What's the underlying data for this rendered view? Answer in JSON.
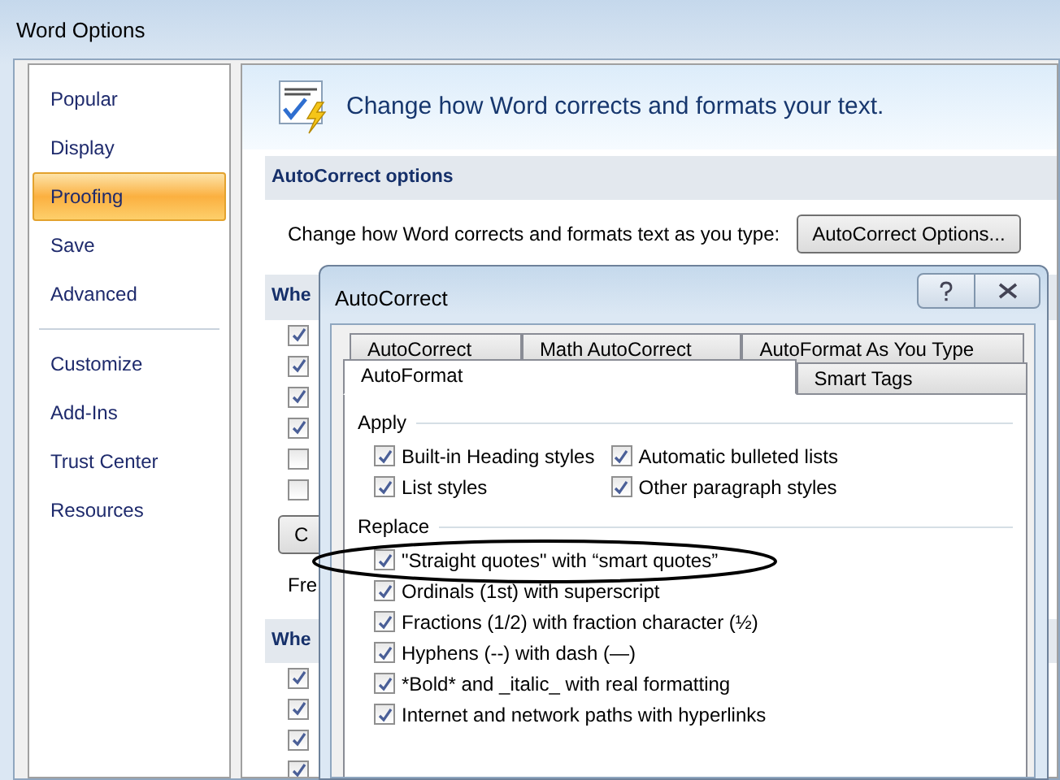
{
  "window": {
    "title": "Word Options"
  },
  "sidebar": {
    "groups": [
      {
        "items": [
          {
            "label": "Popular",
            "selected": false
          },
          {
            "label": "Display",
            "selected": false
          },
          {
            "label": "Proofing",
            "selected": true
          },
          {
            "label": "Save",
            "selected": false
          },
          {
            "label": "Advanced",
            "selected": false
          }
        ]
      },
      {
        "items": [
          {
            "label": "Customize",
            "selected": false
          },
          {
            "label": "Add-Ins",
            "selected": false
          },
          {
            "label": "Trust Center",
            "selected": false
          },
          {
            "label": "Resources",
            "selected": false
          }
        ]
      }
    ]
  },
  "header": {
    "title": "Change how Word corrects and formats your text."
  },
  "sections": [
    {
      "title": "AutoCorrect options",
      "rows": [
        {
          "kind": "action",
          "text": "Change how Word corrects and formats text as you type:",
          "button": "AutoCorrect Options..."
        }
      ]
    },
    {
      "title": "Whe",
      "rows": [
        {
          "kind": "checkbox",
          "checked": true
        },
        {
          "kind": "checkbox",
          "checked": true
        },
        {
          "kind": "checkbox",
          "checked": true
        },
        {
          "kind": "checkbox",
          "checked": true
        },
        {
          "kind": "checkbox",
          "checked": false
        },
        {
          "kind": "checkbox",
          "checked": false
        },
        {
          "kind": "button",
          "label": "C"
        },
        {
          "kind": "text",
          "text": "Fre"
        }
      ]
    },
    {
      "title": "Whe",
      "rows": [
        {
          "kind": "checkbox",
          "checked": true
        },
        {
          "kind": "checkbox",
          "checked": true
        },
        {
          "kind": "checkbox",
          "checked": true
        },
        {
          "kind": "checkbox",
          "checked": true
        }
      ]
    }
  ],
  "dialog": {
    "title": "AutoCorrect",
    "tab_rows": [
      [
        {
          "label": "AutoCorrect",
          "selected": false
        },
        {
          "label": "Math AutoCorrect",
          "selected": false
        },
        {
          "label": "AutoFormat As You Type",
          "selected": false
        }
      ],
      [
        {
          "label": "AutoFormat",
          "selected": true
        },
        {
          "label": "Smart Tags",
          "selected": false
        }
      ]
    ],
    "groups": [
      {
        "title": "Apply",
        "kind": "two-column",
        "options": [
          {
            "label": "Built-in Heading styles",
            "checked": true
          },
          {
            "label": "Automatic bulleted lists",
            "checked": true
          },
          {
            "label": "List styles",
            "checked": true
          },
          {
            "label": "Other paragraph styles",
            "checked": true
          }
        ]
      },
      {
        "title": "Replace",
        "kind": "one-column",
        "options": [
          {
            "label": "\"Straight quotes\" with “smart quotes”",
            "checked": true
          },
          {
            "label": "Ordinals (1st) with superscript",
            "checked": true
          },
          {
            "label": "Fractions (1/2) with fraction character (½)",
            "checked": true
          },
          {
            "label": "Hyphens (--) with dash (—)",
            "checked": true
          },
          {
            "label": "*Bold* and _italic_ with real formatting",
            "checked": true
          },
          {
            "label": "Internet and network paths with hyperlinks",
            "checked": true
          }
        ]
      }
    ]
  }
}
